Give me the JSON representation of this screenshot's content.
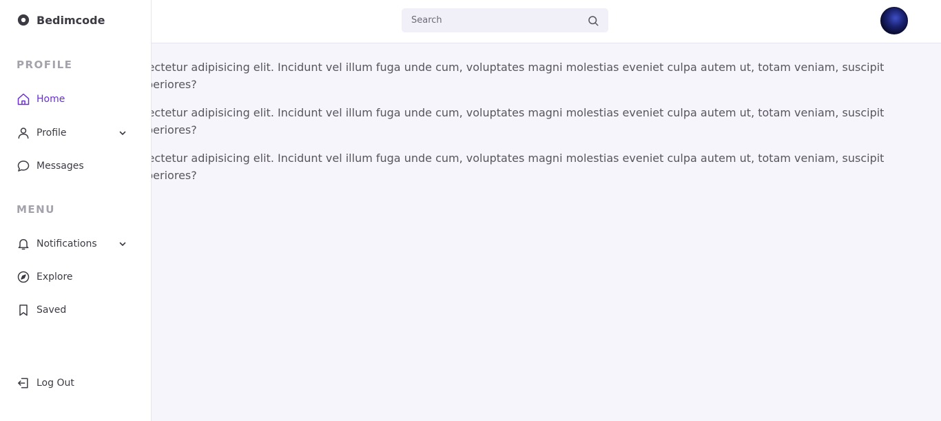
{
  "brand": {
    "name": "Bedimcode",
    "icon": "circle-logo-icon"
  },
  "sidebar": {
    "sections": [
      {
        "title": "PROFILE",
        "items": [
          {
            "label": "Home",
            "icon": "home-icon",
            "active": true
          },
          {
            "label": "Profile",
            "icon": "user-icon",
            "expandable": true
          },
          {
            "label": "Messages",
            "icon": "message-icon"
          }
        ]
      },
      {
        "title": "MENU",
        "items": [
          {
            "label": "Notifications",
            "icon": "bell-icon",
            "expandable": true
          },
          {
            "label": "Explore",
            "icon": "compass-icon"
          },
          {
            "label": "Saved",
            "icon": "bookmark-icon"
          }
        ]
      }
    ],
    "logout": {
      "label": "Log Out",
      "icon": "logout-icon"
    }
  },
  "header": {
    "search": {
      "placeholder": "Search",
      "icon": "search-icon"
    },
    "avatar": {
      "icon": "avatar"
    }
  },
  "content": {
    "paragraphs": [
      "Lorem ipsum dolor sit amet consectetur adipisicing elit. Incidunt vel illum fuga unde cum, voluptates magni molestias eveniet culpa autem ut, totam veniam, suscipit tempore ullam pariatur est at asperiores?",
      "Lorem ipsum dolor sit amet consectetur adipisicing elit. Incidunt vel illum fuga unde cum, voluptates magni molestias eveniet culpa autem ut, totam veniam, suscipit tempore ullam pariatur est at asperiores?",
      "Lorem ipsum dolor sit amet consectetur adipisicing elit. Incidunt vel illum fuga unde cum, voluptates magni molestias eveniet culpa autem ut, totam veniam, suscipit tempore ullam pariatur est at asperiores?"
    ]
  },
  "colors": {
    "accent": "#6b2ed6",
    "text": "#58555e",
    "muted": "#a4a2ab",
    "background": "#f6f5fb"
  }
}
